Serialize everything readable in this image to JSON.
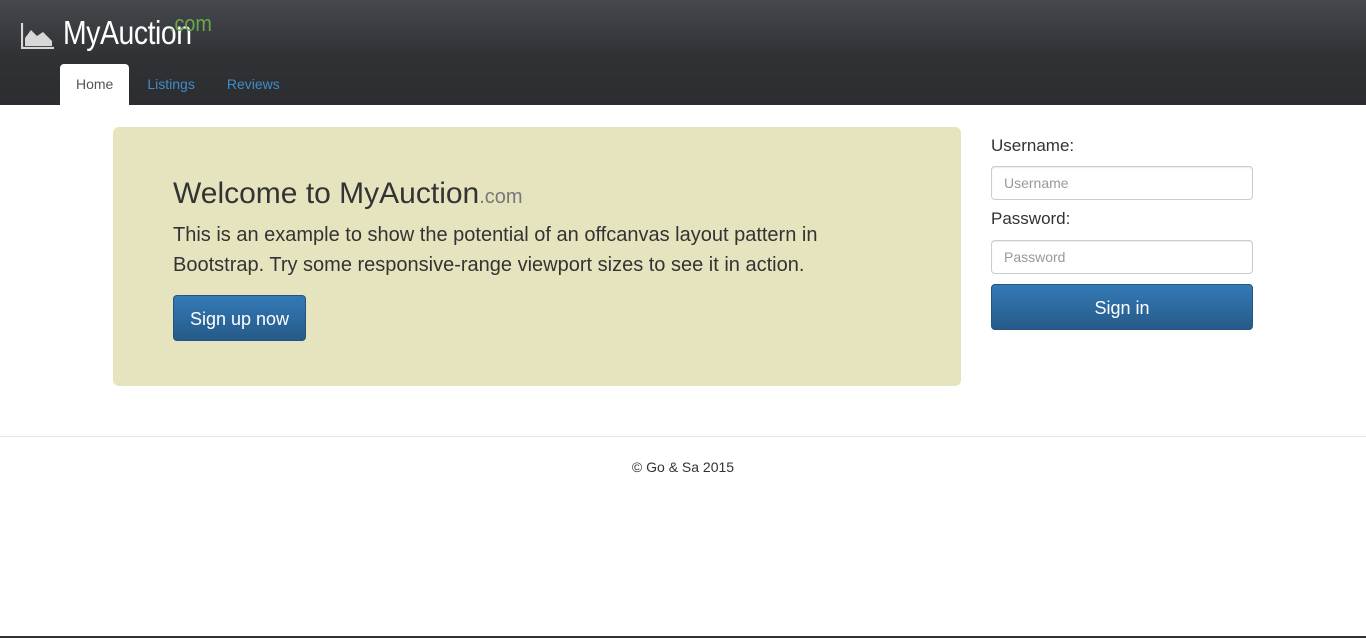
{
  "header": {
    "brand_name": "MyAuction",
    "brand_suffix": ".com",
    "logo_icon": "area-chart-icon",
    "nav": [
      {
        "label": "Home",
        "active": true
      },
      {
        "label": "Listings",
        "active": false
      },
      {
        "label": "Reviews",
        "active": false
      }
    ]
  },
  "jumbotron": {
    "title": "Welcome to MyAuction",
    "title_suffix": ".com",
    "text": "This is an example to show the potential of an offcanvas layout pattern in Bootstrap. Try some responsive-range viewport sizes to see it in action.",
    "button_label": "Sign up now"
  },
  "login": {
    "username_label": "Username:",
    "username_placeholder": "Username",
    "username_value": "",
    "password_label": "Password:",
    "password_placeholder": "Password",
    "password_value": "",
    "button_label": "Sign in"
  },
  "footer": {
    "text": "© Go & Sa 2015"
  },
  "colors": {
    "header_bg": "#2f3135",
    "brand_suffix": "#6aa84f",
    "link": "#428bca",
    "jumbotron_bg": "#e6e4bf",
    "primary_button": "#2b6aa5"
  }
}
